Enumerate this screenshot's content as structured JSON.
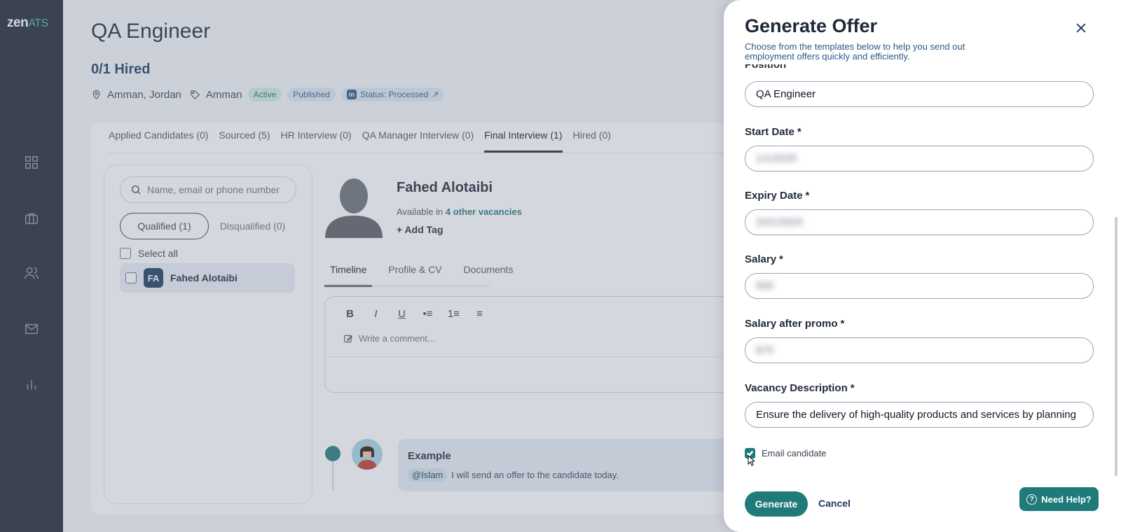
{
  "brand": {
    "logo_main": "zen",
    "logo_accent": "ATS"
  },
  "sidebar": {
    "items": [
      {
        "icon": "grid-icon"
      },
      {
        "icon": "briefcase-icon"
      },
      {
        "icon": "users-icon"
      },
      {
        "icon": "mail-icon"
      },
      {
        "icon": "bar-chart-icon"
      }
    ]
  },
  "job": {
    "title": "QA Engineer",
    "hired": "0/1 Hired",
    "location": "Amman, Jordan",
    "tag": "Amman",
    "badge_active": "Active",
    "badge_published": "Published",
    "linkedin": "in",
    "status": "Status: Processed"
  },
  "stages": [
    {
      "label": "Applied Candidates (0)"
    },
    {
      "label": "Sourced (5)"
    },
    {
      "label": "HR Interview (0)"
    },
    {
      "label": "QA Manager Interview (0)"
    },
    {
      "label": "Final Interview (1)"
    },
    {
      "label": "Hired (0)"
    }
  ],
  "candidates": {
    "search_placeholder": "Name, email or phone number",
    "qualified": "Qualified (1)",
    "disqualified": "Disqualified (0)",
    "select_all": "Select all",
    "rows": [
      {
        "initials": "FA",
        "name": "Fahed Alotaibi"
      }
    ]
  },
  "profile": {
    "name": "Fahed Alotaibi",
    "available_prefix": "Available in",
    "available_link": "4 other vacancies",
    "add_tag": "+ Add Tag",
    "tabs": [
      {
        "label": "Timeline"
      },
      {
        "label": "Profile & CV"
      },
      {
        "label": "Documents"
      }
    ],
    "editor": {
      "toolbar": [
        "B",
        "I",
        "U",
        "•≡",
        "1≡",
        "≡"
      ],
      "placeholder": "Write a comment..."
    },
    "note": {
      "title": "Example",
      "mention": "@Islam",
      "text": "I will send an offer to the candidate today."
    }
  },
  "modal": {
    "title": "Generate Offer",
    "subtitle": "Choose from the templates below to help you send out employment offers quickly and efficiently.",
    "cut_label": "Position",
    "position_value": "QA Engineer",
    "fields": {
      "start_date": {
        "label": "Start Date",
        "required": "*",
        "value": "1/1/2025"
      },
      "expiry_date": {
        "label": "Expiry Date",
        "required": "*",
        "value": "20/1/2025"
      },
      "salary": {
        "label": "Salary",
        "required": "*",
        "value": "950"
      },
      "salary_promo": {
        "label": "Salary after promo",
        "required": "*",
        "value": "875"
      },
      "vacancy_desc": {
        "label": "Vacancy Description",
        "required": "*",
        "value": "Ensure the delivery of high-quality products and services by planning"
      }
    },
    "email_candidate": "Email candidate",
    "generate": "Generate",
    "cancel": "Cancel"
  },
  "help": {
    "label": "Need Help?"
  }
}
